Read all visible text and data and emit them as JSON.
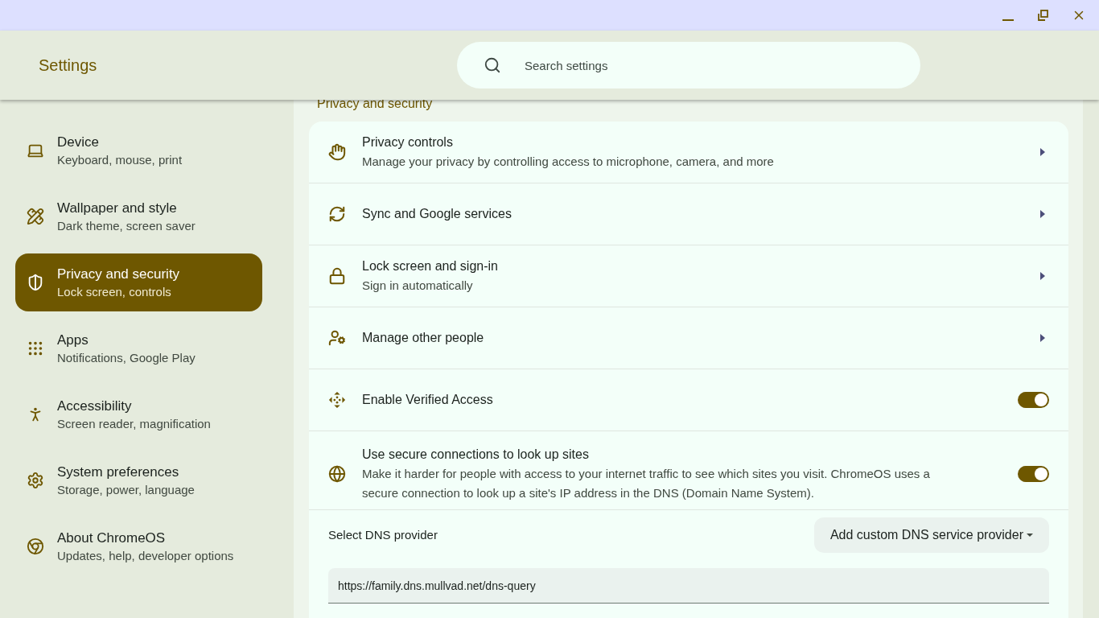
{
  "window": {
    "title": "Settings"
  },
  "search": {
    "placeholder": "Search settings"
  },
  "sidebar": {
    "items": [
      {
        "title": "Device",
        "subtitle": "Keyboard, mouse, print",
        "selected": false
      },
      {
        "title": "Wallpaper and style",
        "subtitle": "Dark theme, screen saver",
        "selected": false
      },
      {
        "title": "Privacy and security",
        "subtitle": "Lock screen, controls",
        "selected": true
      },
      {
        "title": "Apps",
        "subtitle": "Notifications, Google Play",
        "selected": false
      },
      {
        "title": "Accessibility",
        "subtitle": "Screen reader, magnification",
        "selected": false
      },
      {
        "title": "System preferences",
        "subtitle": "Storage, power, language",
        "selected": false
      },
      {
        "title": "About ChromeOS",
        "subtitle": "Updates, help, developer options",
        "selected": false
      }
    ]
  },
  "section": {
    "title": "Privacy and security",
    "rows": [
      {
        "kind": "link",
        "title": "Privacy controls",
        "subtitle": "Manage your privacy by controlling access to microphone, camera, and more"
      },
      {
        "kind": "link",
        "title": "Sync and Google services"
      },
      {
        "kind": "link",
        "title": "Lock screen and sign-in",
        "subtitle": "Sign in automatically"
      },
      {
        "kind": "link",
        "title": "Manage other people"
      },
      {
        "kind": "toggle",
        "title": "Enable Verified Access",
        "on": true
      },
      {
        "kind": "toggle",
        "title": "Use secure connections to look up sites",
        "subtitle": "Make it harder for people with access to your internet traffic to see which sites you visit. ChromeOS uses a secure connection to look up a site's IP address in the DNS (Domain Name System).",
        "on": true
      }
    ],
    "dns": {
      "label": "Select DNS provider",
      "dropdown": "Add custom DNS service provider",
      "input": "https://family.dns.mullvad.net/dns-query"
    }
  }
}
